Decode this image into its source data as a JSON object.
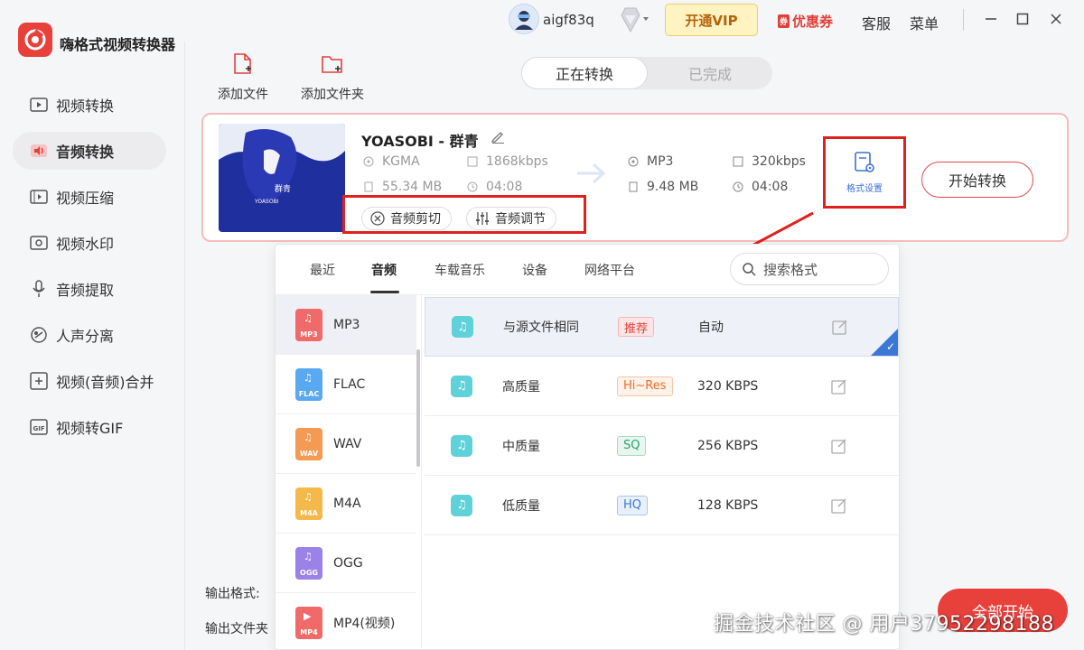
{
  "app": {
    "title": "嗨格式视频转换器"
  },
  "header": {
    "username": "aigf83q",
    "vip_label": "开通VIP",
    "coupon_label": "优惠券",
    "coupon_tag": "券",
    "service_label": "客服",
    "menu_label": "菜单"
  },
  "sidebar": {
    "items": [
      {
        "label": "视频转换",
        "icon": "video-convert-icon"
      },
      {
        "label": "音频转换",
        "icon": "audio-convert-icon",
        "active": true
      },
      {
        "label": "视频压缩",
        "icon": "video-compress-icon"
      },
      {
        "label": "视频水印",
        "icon": "watermark-icon"
      },
      {
        "label": "音频提取",
        "icon": "microphone-icon"
      },
      {
        "label": "人声分离",
        "icon": "voice-separate-icon"
      },
      {
        "label": "视频(音频)合并",
        "icon": "merge-icon"
      },
      {
        "label": "视频转GIF",
        "icon": "gif-icon"
      }
    ]
  },
  "toolbar": {
    "add_file": "添加文件",
    "add_folder": "添加文件夹"
  },
  "status_tabs": {
    "converting": "正在转换",
    "completed": "已完成",
    "active": "converting"
  },
  "file": {
    "title": "YOASOBI - 群青",
    "cover_text": "群青",
    "cover_artist": "YOASOBI",
    "source": {
      "format": "KGMA",
      "bitrate": "1868kbps",
      "size": "55.34 MB",
      "duration": "04:08"
    },
    "target": {
      "format": "MP3",
      "bitrate": "320kbps",
      "size": "9.48 MB",
      "duration": "04:08"
    },
    "cut_label": "音频剪切",
    "adjust_label": "音频调节",
    "format_settings_label": "格式设置",
    "start_label": "开始转换"
  },
  "format_panel": {
    "tabs": [
      "最近",
      "音频",
      "车载音乐",
      "设备",
      "网络平台"
    ],
    "active_tab": "音频",
    "search_placeholder": "搜索格式",
    "formats": [
      {
        "name": "MP3",
        "label": "MP3",
        "color": "#f06a6a"
      },
      {
        "name": "FLAC",
        "label": "FLAC",
        "color": "#5aa8f0"
      },
      {
        "name": "WAV",
        "label": "WAV",
        "color": "#f59a52"
      },
      {
        "name": "M4A",
        "label": "M4A",
        "color": "#f5b84a"
      },
      {
        "name": "OGG",
        "label": "OGG",
        "color": "#9b82e8"
      },
      {
        "name": "MP4(视频)",
        "label": "MP4",
        "color": "#f06a6a"
      }
    ],
    "qualities": [
      {
        "name": "与源文件相同",
        "tag": "推荐",
        "value": "自动"
      },
      {
        "name": "高质量",
        "tag": "Hi~Res",
        "value": "320 KBPS"
      },
      {
        "name": "中质量",
        "tag": "SQ",
        "value": "256 KBPS"
      },
      {
        "name": "低质量",
        "tag": "HQ",
        "value": "128 KBPS"
      }
    ]
  },
  "bottom": {
    "output_format_label": "输出格式:",
    "output_folder_label": "输出文件夹",
    "start_all_label": "全部开始"
  },
  "watermark": "掘金技术社区 @ 用户3795229818​8"
}
